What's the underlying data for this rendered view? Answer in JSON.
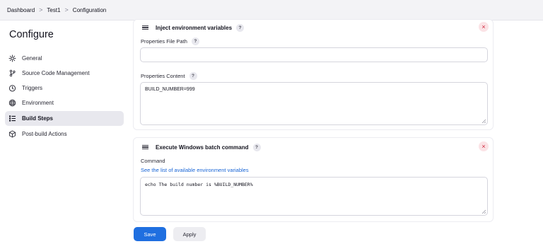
{
  "breadcrumb": [
    "Dashboard",
    "Test1",
    "Configuration"
  ],
  "breadcrumb_separator": ">",
  "sidebar": {
    "title": "Configure",
    "items": [
      {
        "label": "General",
        "icon": "gear-icon",
        "active": false
      },
      {
        "label": "Source Code Management",
        "icon": "branch-icon",
        "active": false
      },
      {
        "label": "Triggers",
        "icon": "clock-icon",
        "active": false
      },
      {
        "label": "Environment",
        "icon": "globe-icon",
        "active": false
      },
      {
        "label": "Build Steps",
        "icon": "list-icon",
        "active": true
      },
      {
        "label": "Post-build Actions",
        "icon": "package-icon",
        "active": false
      }
    ]
  },
  "inject_step": {
    "title": "Inject environment variables",
    "help": "?",
    "close": "×",
    "properties_file_label": "Properties File Path",
    "properties_file_value": "",
    "properties_content_label": "Properties Content",
    "properties_content_value": "BUILD_NUMBER=999"
  },
  "batch_step": {
    "title": "Execute Windows batch command",
    "help": "?",
    "close": "×",
    "command_label": "Command",
    "env_link": "See the list of available environment variables",
    "command_value": "echo The build number is %BUILD_NUMBER%"
  },
  "actions": {
    "save": "Save",
    "apply": "Apply"
  },
  "colors": {
    "primary": "#1f6fe0",
    "link": "#1a66d6",
    "close": "#d0263b",
    "active_nav_bg": "#e8e8ee"
  }
}
